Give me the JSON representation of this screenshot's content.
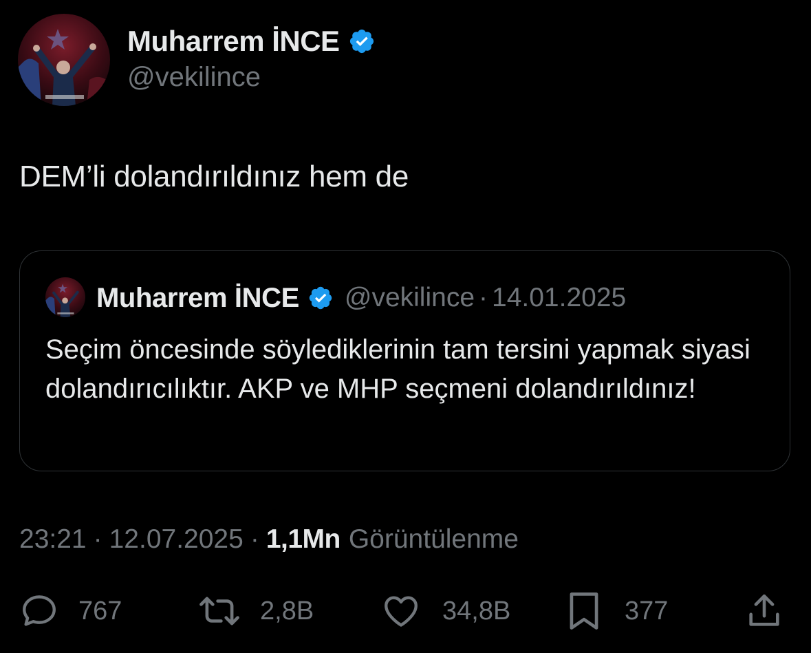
{
  "author": {
    "name": "Muharrem İNCE",
    "handle": "@vekilince",
    "verified": true,
    "avatar_icon": "profile-photo"
  },
  "tweet": {
    "text": "DEM’li dolandırıldınız hem de"
  },
  "quoted_tweet": {
    "name": "Muharrem İNCE",
    "handle": "@vekilince",
    "separator": "·",
    "date": "14.01.2025",
    "text": "Seçim öncesinde söylediklerinin tam tersini yapmak siyasi dolandırıcılıktır. AKP ve MHP seçmeni dolandırıldınız!"
  },
  "meta": {
    "time": "23:21",
    "separator": "·",
    "date": "12.07.2025",
    "views_count": "1,1Mn",
    "views_label": "Görüntülenme"
  },
  "actions": {
    "replies": {
      "icon": "reply-icon",
      "count": "767"
    },
    "reposts": {
      "icon": "repost-icon",
      "count": "2,8B"
    },
    "likes": {
      "icon": "heart-icon",
      "count": "34,8B"
    },
    "bookmarks": {
      "icon": "bookmark-icon",
      "count": "377"
    },
    "share": {
      "icon": "share-icon"
    }
  },
  "colors": {
    "background": "#000000",
    "text_primary": "#e7e9ea",
    "text_secondary": "#71767b",
    "verified_blue": "#1d9bf0",
    "border": "#2f3336"
  }
}
